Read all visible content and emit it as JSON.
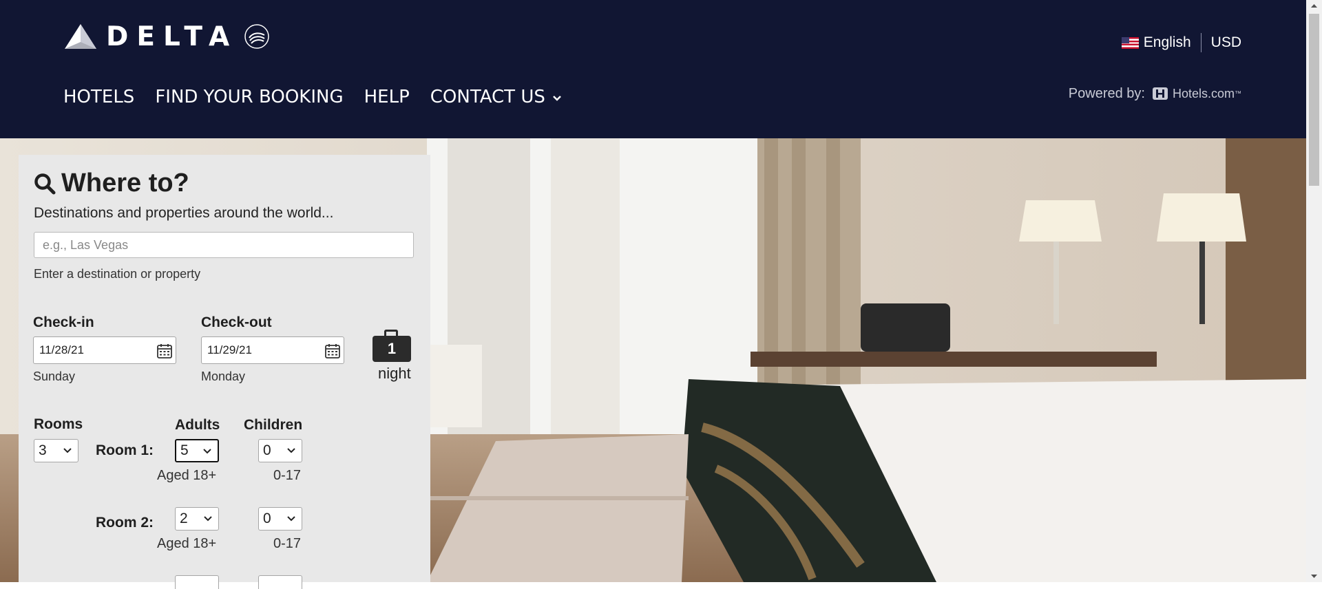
{
  "header": {
    "brand": "DELTA",
    "nav": [
      {
        "label": "HOTELS"
      },
      {
        "label": "FIND YOUR BOOKING"
      },
      {
        "label": "HELP"
      },
      {
        "label": "CONTACT US"
      }
    ],
    "language": "English",
    "currency": "USD",
    "powered_by": "Powered by:",
    "partner": "Hotels.com",
    "partner_tm": "™"
  },
  "search": {
    "title": "Where to?",
    "subtitle": "Destinations and properties around the world...",
    "destination_placeholder": "e.g., Las Vegas",
    "destination_value": "",
    "destination_help": "Enter a destination or property",
    "checkin_label": "Check-in",
    "checkin_value": "11/28/21",
    "checkin_day": "Sunday",
    "checkout_label": "Check-out",
    "checkout_value": "11/29/21",
    "checkout_day": "Monday",
    "nights_count": "1",
    "nights_label": "night",
    "rooms_label": "Rooms",
    "rooms_value": "3",
    "adults_label": "Adults",
    "children_label": "Children",
    "rooms": [
      {
        "label": "Room 1:",
        "adults": "5",
        "children": "0",
        "adults_hint": "Aged 18+",
        "children_hint": "0-17"
      },
      {
        "label": "Room 2:",
        "adults": "2",
        "children": "0",
        "adults_hint": "Aged 18+",
        "children_hint": "0-17"
      }
    ]
  },
  "colors": {
    "header_bg": "#111633",
    "panel_bg": "#e8e8e8"
  }
}
